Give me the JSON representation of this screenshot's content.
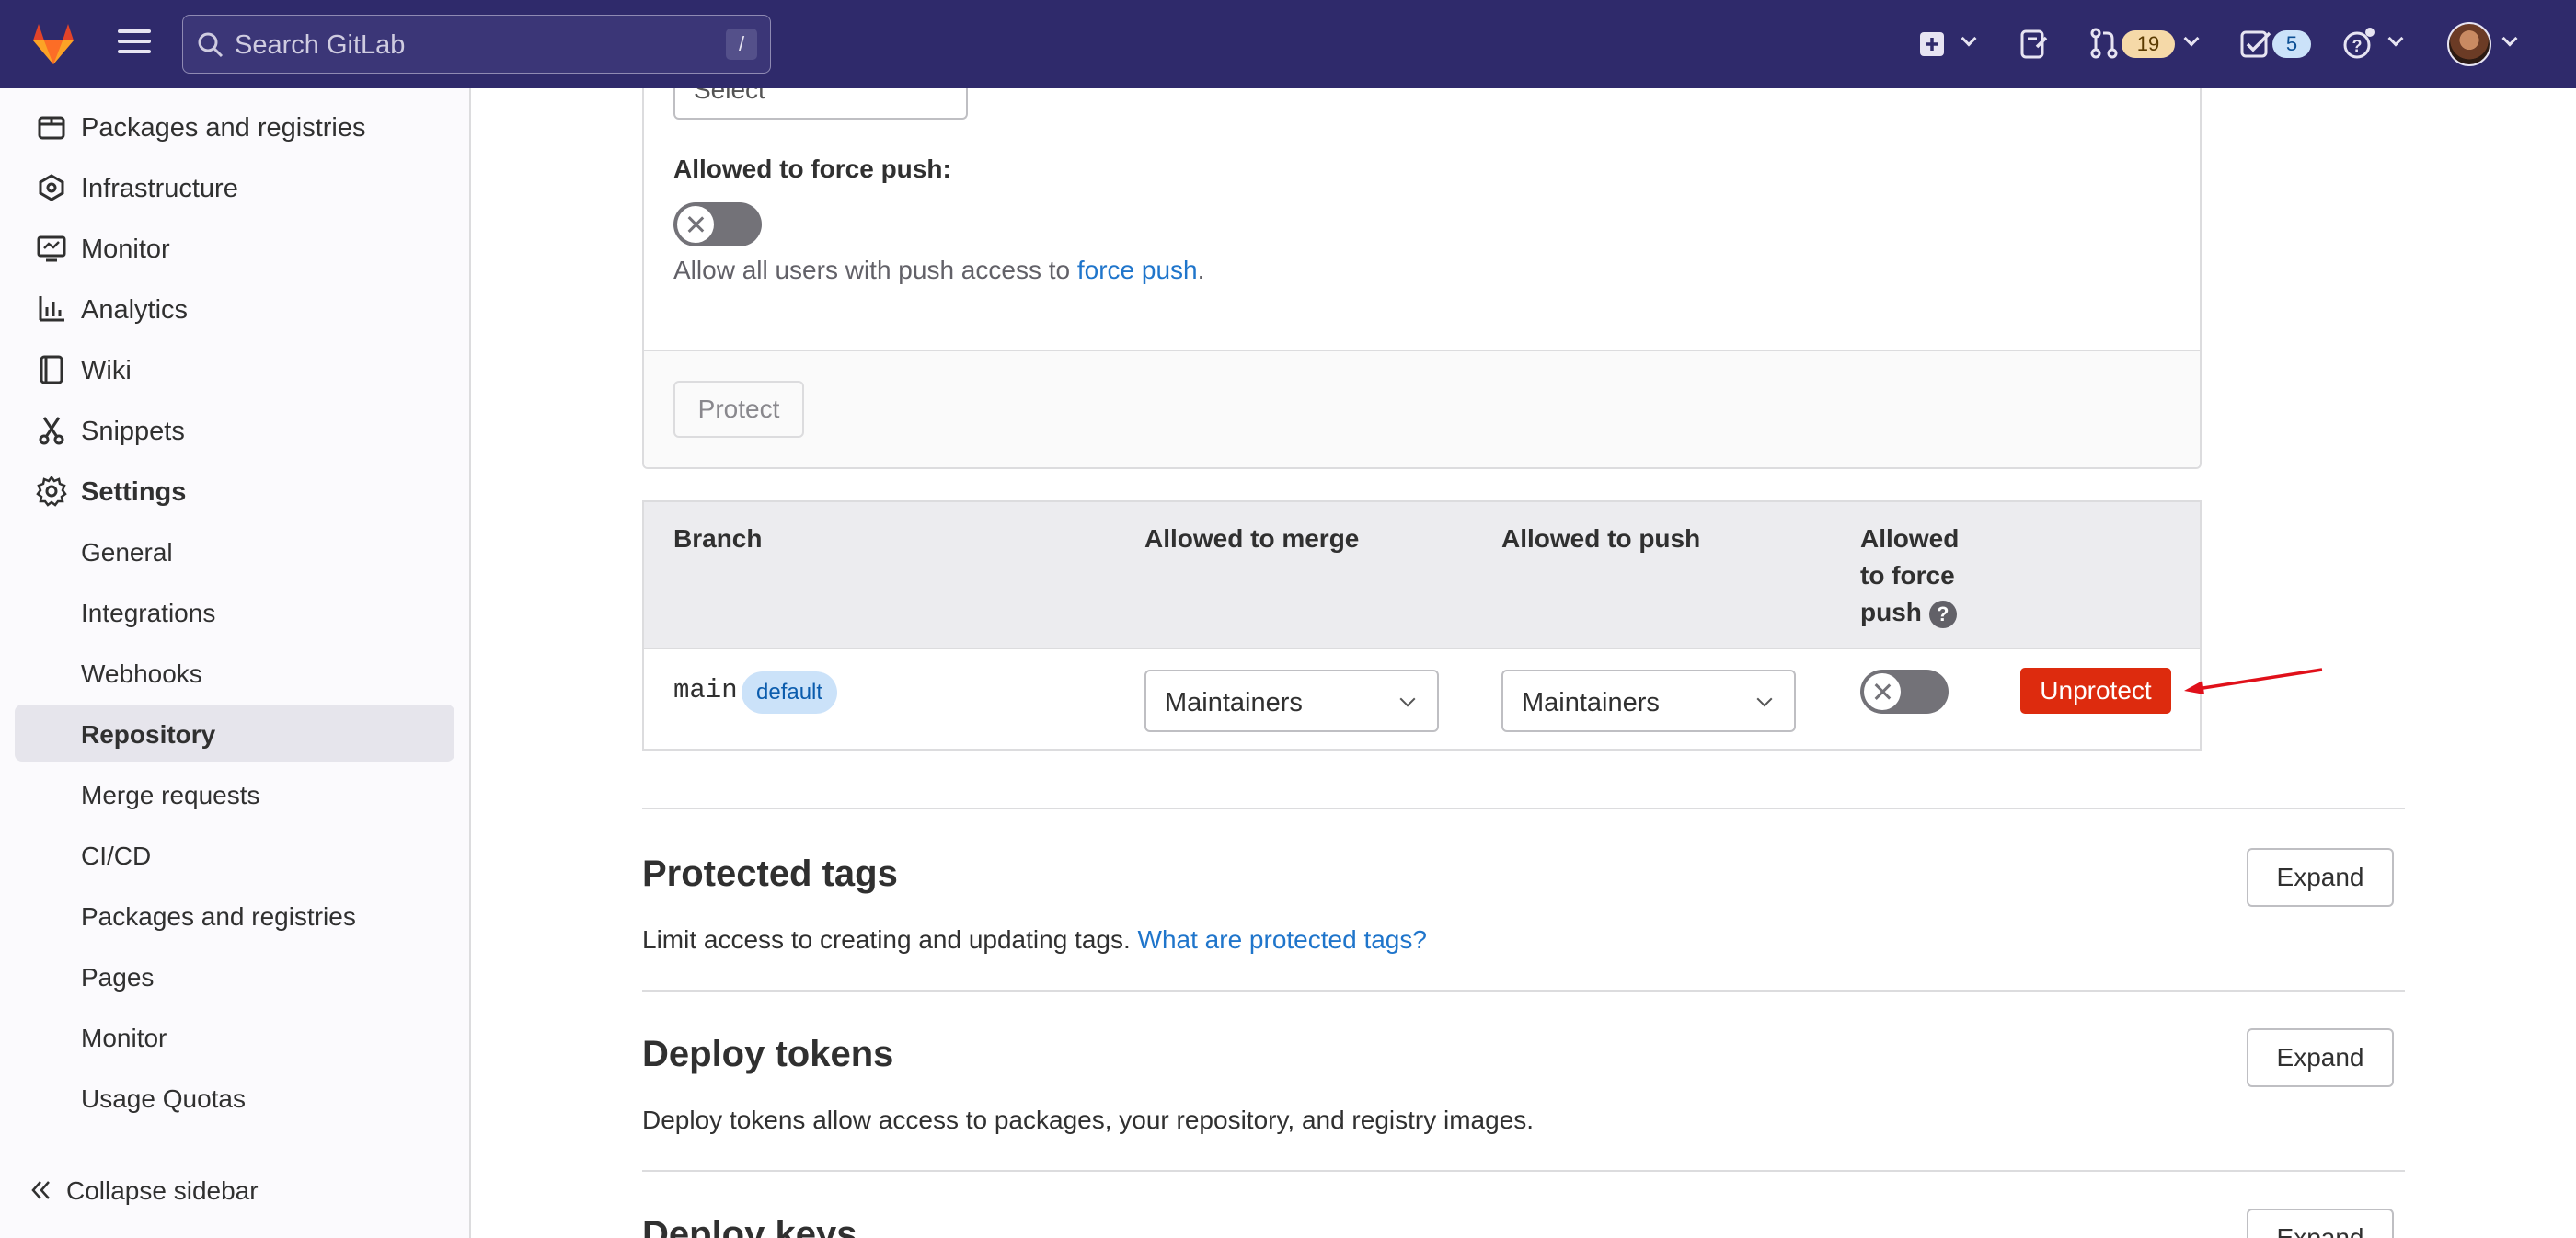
{
  "topbar": {
    "search_placeholder": "Search GitLab",
    "search_shortcut": "/",
    "merge_requests_count": "19",
    "todos_count": "5"
  },
  "sidebar": {
    "items": [
      {
        "label": "Packages and registries",
        "icon": "package-icon"
      },
      {
        "label": "Infrastructure",
        "icon": "cloud-icon"
      },
      {
        "label": "Monitor",
        "icon": "monitor-icon"
      },
      {
        "label": "Analytics",
        "icon": "chart-icon"
      },
      {
        "label": "Wiki",
        "icon": "book-icon"
      },
      {
        "label": "Snippets",
        "icon": "scissors-icon"
      },
      {
        "label": "Settings",
        "icon": "gear-icon"
      }
    ],
    "settings_sub": [
      "General",
      "Integrations",
      "Webhooks",
      "Repository",
      "Merge requests",
      "CI/CD",
      "Packages and registries",
      "Pages",
      "Monitor",
      "Usage Quotas"
    ],
    "active_sub": "Repository",
    "collapse_label": "Collapse sidebar"
  },
  "protect_form": {
    "select_placeholder": "Select",
    "force_push_label": "Allowed to force push:",
    "force_push_help_prefix": "Allow all users with push access to ",
    "force_push_help_link": "force push",
    "force_push_help_suffix": ".",
    "protect_button": "Protect"
  },
  "branches_table": {
    "headers": {
      "branch": "Branch",
      "merge": "Allowed to merge",
      "push": "Allowed to push",
      "force_push_1": "Allowed",
      "force_push_2": "to force",
      "force_push_3": "push"
    },
    "rows": [
      {
        "branch": "main",
        "badge": "default",
        "merge": "Maintainers",
        "push": "Maintainers",
        "force_push": false,
        "action": "Unprotect"
      }
    ]
  },
  "sections": [
    {
      "title": "Protected tags",
      "description": "Limit access to creating and updating tags. ",
      "link": "What are protected tags?",
      "button": "Expand"
    },
    {
      "title": "Deploy tokens",
      "description": "Deploy tokens allow access to packages, your repository, and registry images.",
      "button": "Expand"
    },
    {
      "title": "Deploy keys",
      "button": "Expand"
    }
  ],
  "colors": {
    "topbar": "#2f2a6b",
    "danger": "#dd2b0e",
    "link": "#1f75cb",
    "annotation_arrow": "#e0101a"
  }
}
